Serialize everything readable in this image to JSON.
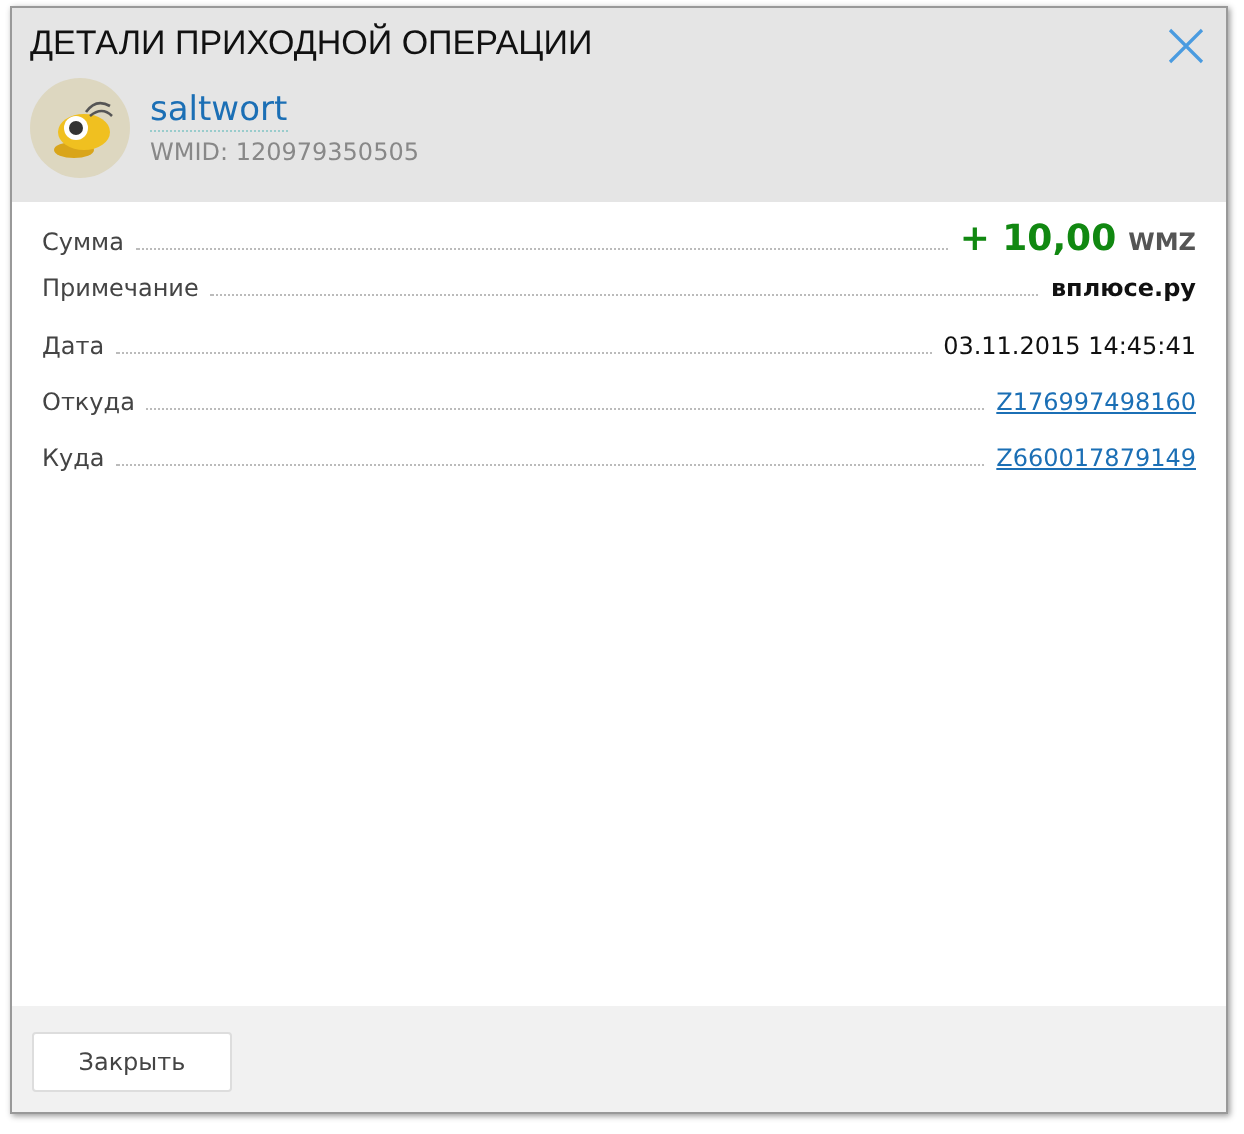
{
  "dialog": {
    "title": "ДЕТАЛИ ПРИХОДНОЙ ОПЕРАЦИИ"
  },
  "user": {
    "name": "saltwort",
    "wmid": "WMID: 120979350505"
  },
  "details": [
    {
      "label": "Сумма",
      "kind": "amount",
      "value": "+ 10,00",
      "unit": "WMZ"
    },
    {
      "label": "Примечание",
      "kind": "bold",
      "value": "вплюсе.ру"
    },
    {
      "label": "Дата",
      "kind": "text",
      "value": "03.11.2015 14:45:41"
    },
    {
      "label": "Откуда",
      "kind": "link",
      "value": "Z176997498160"
    },
    {
      "label": "Куда",
      "kind": "link",
      "value": "Z660017879149"
    }
  ],
  "buttons": [
    "Закрыть"
  ]
}
